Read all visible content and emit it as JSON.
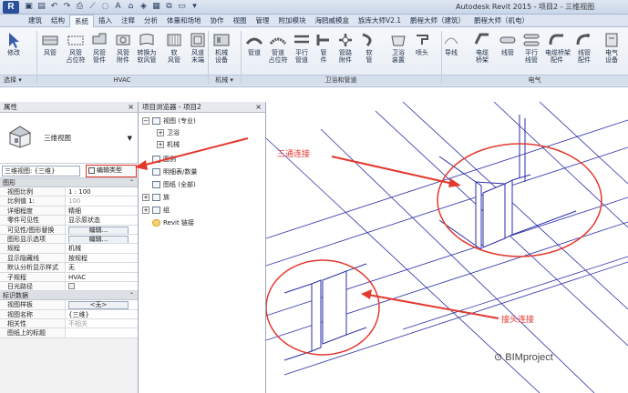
{
  "window": {
    "title": "Autodesk Revit 2015 -   项目2 - 三维视图"
  },
  "tabs": [
    "建筑",
    "结构",
    "系统",
    "插入",
    "注释",
    "分析",
    "体量和场地",
    "协作",
    "视图",
    "管理",
    "附加模块",
    "海鸥威模盒",
    "族库大师V2.1",
    "鹏程大师（建筑）",
    "鹏程大师（机电）"
  ],
  "active_tab": "系统",
  "ribbon": {
    "tools": [
      {
        "label": "修改",
        "sub": ""
      },
      {
        "label": "风管",
        "sub": ""
      },
      {
        "label": "风管",
        "sub": "占位符"
      },
      {
        "label": "风管",
        "sub": "管件"
      },
      {
        "label": "风管",
        "sub": "附件"
      },
      {
        "label": "转换为",
        "sub": "软风管"
      },
      {
        "label": "软",
        "sub": "风管"
      },
      {
        "label": "风道",
        "sub": "末端"
      },
      {
        "label": "机械",
        "sub": "设备"
      },
      {
        "label": "管道",
        "sub": ""
      },
      {
        "label": "管道",
        "sub": "占位符"
      },
      {
        "label": "平行",
        "sub": "管道"
      },
      {
        "label": "管",
        "sub": "件"
      },
      {
        "label": "管路",
        "sub": "附件"
      },
      {
        "label": "软",
        "sub": "管"
      },
      {
        "label": "卫浴",
        "sub": "装置"
      },
      {
        "label": "喷头",
        "sub": ""
      },
      {
        "label": "导线",
        "sub": ""
      },
      {
        "label": "电缆",
        "sub": "桥架"
      },
      {
        "label": "线管",
        "sub": ""
      },
      {
        "label": "平行",
        "sub": "线管"
      },
      {
        "label": "电缆桥架",
        "sub": "配件"
      },
      {
        "label": "线管",
        "sub": "配件"
      },
      {
        "label": "电气",
        "sub": "设备"
      }
    ],
    "groups": {
      "select": "选择 ▾",
      "hvac": "HVAC",
      "mechanical": "机械 ▾",
      "plumbing": "卫浴和管道",
      "electrical": "电气"
    }
  },
  "properties": {
    "title": "属性",
    "close": "×",
    "type_name": "三维视图",
    "selector_value": "三维视图: {三维}",
    "edit_type_label": "编辑类型",
    "sections": [
      {
        "name": "图形",
        "rows": [
          {
            "k": "视图比例",
            "v": "1 : 100",
            "kind": "input"
          },
          {
            "k": "比例值 1:",
            "v": "100",
            "kind": "grey"
          },
          {
            "k": "详细程度",
            "v": "精细",
            "kind": "text"
          },
          {
            "k": "零件可见性",
            "v": "显示原状态",
            "kind": "text"
          },
          {
            "k": "可见性/图形替换",
            "v": "编辑...",
            "kind": "button"
          },
          {
            "k": "图形显示选项",
            "v": "编辑...",
            "kind": "button"
          },
          {
            "k": "规程",
            "v": "机械",
            "kind": "text"
          },
          {
            "k": "显示隐藏线",
            "v": "按规程",
            "kind": "text"
          },
          {
            "k": "默认分析显示样式",
            "v": "无",
            "kind": "text"
          },
          {
            "k": "子规程",
            "v": "HVAC",
            "kind": "text"
          },
          {
            "k": "日光路径",
            "v": "",
            "kind": "check"
          }
        ]
      },
      {
        "name": "标识数据",
        "rows": [
          {
            "k": "视图样板",
            "v": "<无>",
            "kind": "button"
          },
          {
            "k": "视图名称",
            "v": "{三维}",
            "kind": "text"
          },
          {
            "k": "相关性",
            "v": "不相关",
            "kind": "grey"
          },
          {
            "k": "图纸上的标题",
            "v": "",
            "kind": "text"
          }
        ]
      }
    ]
  },
  "browser": {
    "title": "项目浏览器 - 项目2",
    "close": "×",
    "items": [
      {
        "label": "视图 (专业)",
        "level": 0,
        "expand": "−",
        "icon": "views"
      },
      {
        "label": "卫浴",
        "level": 1,
        "expand": "+",
        "icon": ""
      },
      {
        "label": "机械",
        "level": 1,
        "expand": "+",
        "icon": ""
      },
      {
        "label": "图例",
        "level": 0,
        "expand": "",
        "icon": "legend"
      },
      {
        "label": "明细表/数量",
        "level": 0,
        "expand": "",
        "icon": "schedule"
      },
      {
        "label": "图纸 (全部)",
        "level": 0,
        "expand": "",
        "icon": "sheet"
      },
      {
        "label": "族",
        "level": 0,
        "expand": "+",
        "icon": "family"
      },
      {
        "label": "组",
        "level": 0,
        "expand": "+",
        "icon": "group"
      },
      {
        "label": "Revit 链接",
        "level": 0,
        "expand": "",
        "icon": "link"
      }
    ]
  },
  "canvas": {
    "annotation_tee": "三通连接",
    "annotation_joint": "接头连接",
    "watermark": "BIMproject"
  },
  "colors": {
    "accent_red": "#e3382e",
    "duct_line": "#2b2fa8",
    "ribbon_bg": "#e6ecf4"
  }
}
